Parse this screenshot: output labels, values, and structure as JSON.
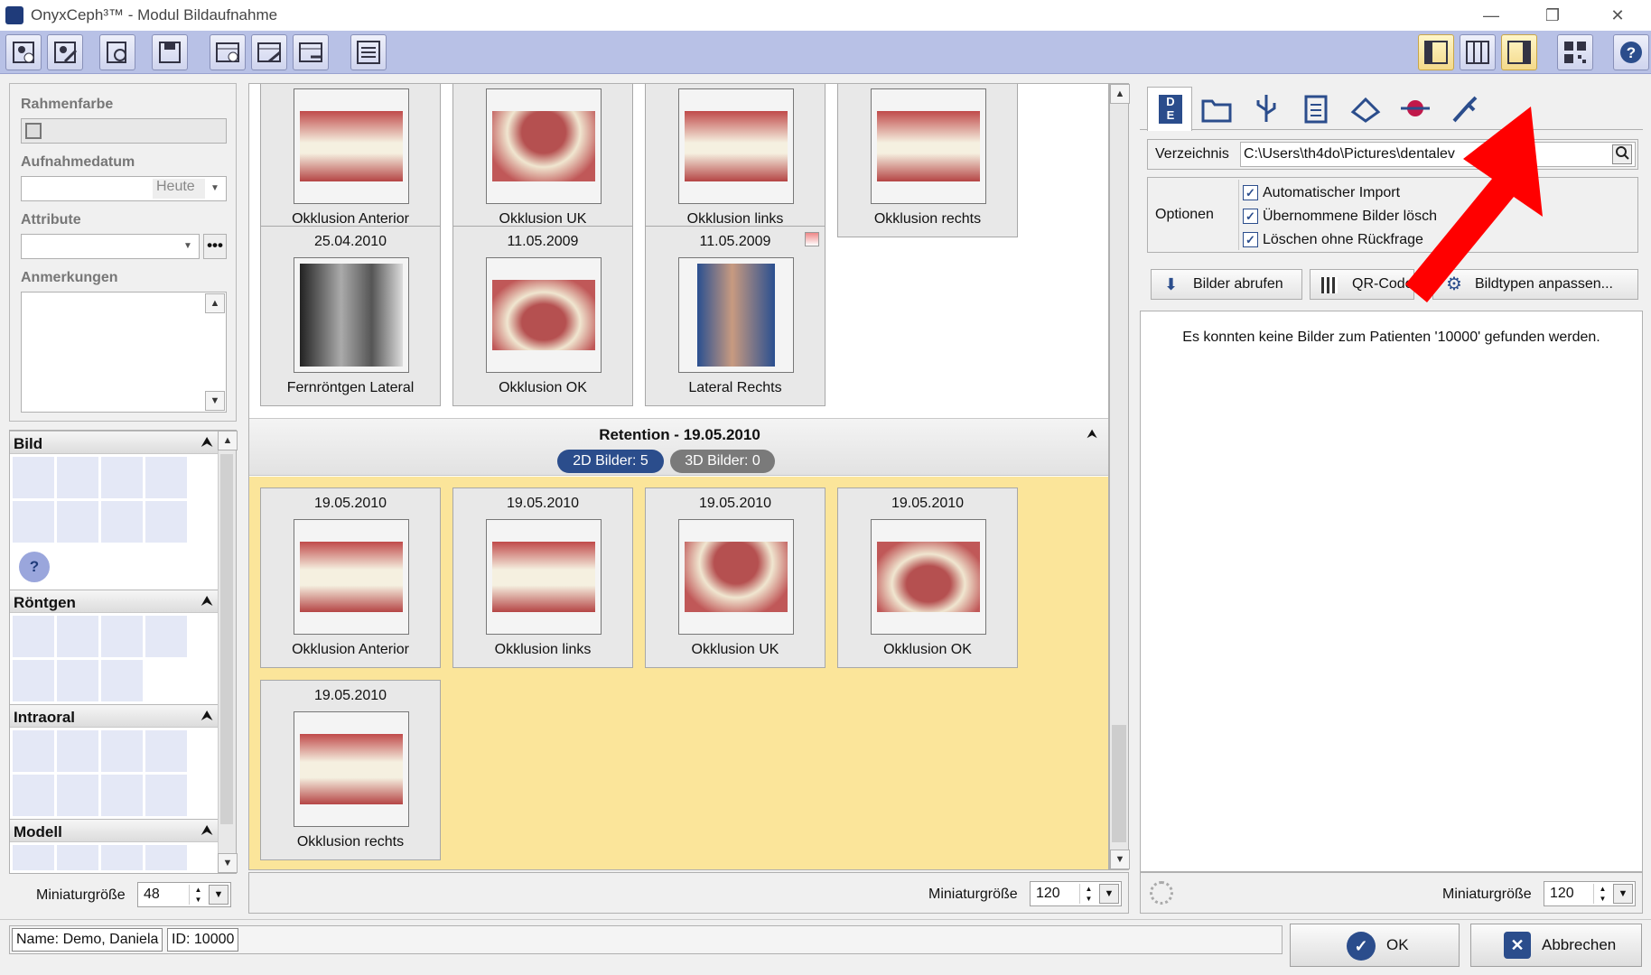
{
  "window": {
    "title": "OnyxCeph³™ - Modul Bildaufnahme",
    "minimize": "—",
    "maximize": "❐",
    "close": "✕"
  },
  "left": {
    "rahmenfarbe_label": "Rahmenfarbe",
    "aufnahmedatum_label": "Aufnahmedatum",
    "heute": "Heute",
    "attribute_label": "Attribute",
    "anmerkungen_label": "Anmerkungen",
    "categories": {
      "bild": "Bild",
      "roentgen": "Röntgen",
      "intraoral": "Intraoral",
      "modell": "Modell"
    },
    "miniatur_label": "Miniaturgröße",
    "miniatur_value": "48"
  },
  "center": {
    "top_row": [
      "Okklusion Anterior",
      "Okklusion UK",
      "Okklusion links",
      "Okklusion rechts"
    ],
    "row2": [
      {
        "date": "25.04.2010",
        "caption": "Fernröntgen Lateral"
      },
      {
        "date": "11.05.2009",
        "caption": "Okklusion OK"
      },
      {
        "date": "11.05.2009",
        "caption": "Lateral Rechts"
      }
    ],
    "group": {
      "title": "Retention - 19.05.2010",
      "badge2d": "2D Bilder: 5",
      "badge3d": "3D Bilder: 0"
    },
    "retention": [
      {
        "date": "19.05.2010",
        "caption": "Okklusion Anterior"
      },
      {
        "date": "19.05.2010",
        "caption": "Okklusion links"
      },
      {
        "date": "19.05.2010",
        "caption": "Okklusion UK"
      },
      {
        "date": "19.05.2010",
        "caption": "Okklusion OK"
      },
      {
        "date": "19.05.2010",
        "caption": "Okklusion rechts"
      }
    ],
    "miniatur_label": "Miniaturgröße",
    "miniatur_value": "120"
  },
  "right": {
    "lang_top": "D",
    "lang_bottom": "E",
    "verzeichnis_label": "Verzeichnis",
    "verzeichnis_value": "C:\\Users\\th4do\\Pictures\\dentalev",
    "optionen_label": "Optionen",
    "options": [
      "Automatischer Import",
      "Übernommene Bilder lösch",
      "Löschen ohne Rückfrage"
    ],
    "btn_abrufen": "Bilder abrufen",
    "btn_qr": "QR-Code",
    "btn_bildtypen": "Bildtypen anpassen...",
    "message": "Es konnten keine Bilder zum Patienten '10000' gefunden werden.",
    "miniatur_label": "Miniaturgröße",
    "miniatur_value": "120"
  },
  "status": {
    "name": "Name: Demo, Daniela",
    "id": "ID: 10000",
    "ok": "OK",
    "cancel": "Abbrechen"
  },
  "colors": {
    "accent": "#2b4d8c",
    "group_bg": "#fbe59a",
    "arrow": "#ff0000"
  }
}
